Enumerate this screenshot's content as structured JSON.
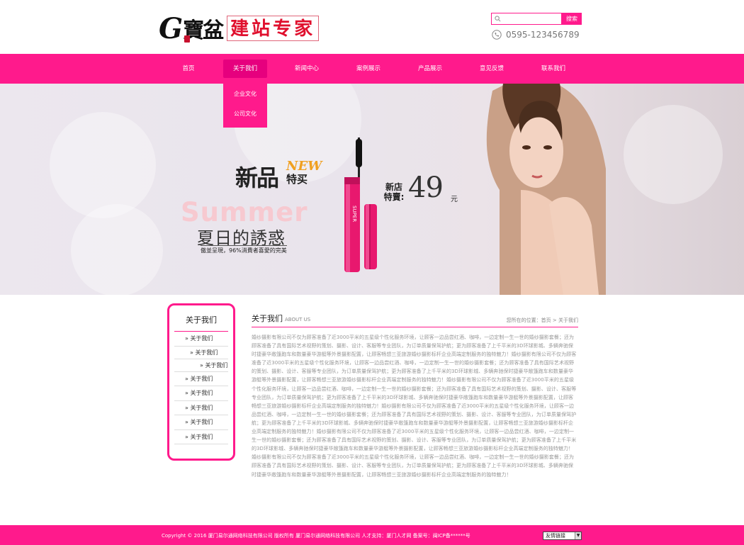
{
  "header": {
    "logo_g": "G",
    "logo_brand": "寶盆",
    "logo_box": "建站专家",
    "search_placeholder": "",
    "search_button": "搜索",
    "phone": "0595-123456789"
  },
  "nav": {
    "items": [
      {
        "label": "首页"
      },
      {
        "label": "关于我们"
      },
      {
        "label": "新闻中心"
      },
      {
        "label": "案例展示"
      },
      {
        "label": "产品展示"
      },
      {
        "label": "意见反馈"
      },
      {
        "label": "联系我们"
      }
    ],
    "dropdown": [
      "企业文化",
      "公司文化"
    ]
  },
  "banner": {
    "new_cn": "新品",
    "new_en": "NEW",
    "special": "特买",
    "summer": "Summer",
    "summer_cn": "夏日的誘惑",
    "slogan": "傲並呈現，96%消費者喜愛的完美",
    "shop": "新店特賣:",
    "price": "49",
    "yuan": "元"
  },
  "sidebar": {
    "title": "关于我们",
    "items": [
      {
        "label": "关于我们"
      },
      {
        "label": "关于我们",
        "level": 1
      },
      {
        "label": "关于我们",
        "level": 2
      },
      {
        "label": "关于我们"
      },
      {
        "label": "关于我们"
      },
      {
        "label": "关于我们"
      },
      {
        "label": "关于我们"
      },
      {
        "label": "关于我们"
      }
    ]
  },
  "main": {
    "title": "关于我们",
    "title_en": "ABOUT US",
    "breadcrumb": "您所在的位置：首页 > 关于我们",
    "body": "婚纱摄影有限公司不仅为顾客准备了近3000平米的五星级个性化服务环境，让顾客一边品尝红酒、咖啡，一边定制一生一世的婚纱摄影套餐；还为顾客准备了具有国际艺术视野的策划、摄影、设计、客服等专业团队，为订单质量保驾护航；更为顾客准备了上千平米的3D环球影城、多辆奔驰保时捷豪华敞篷跑车和数量豪华游艇等外景摄影配置，让顾客畅想三亚旅游婚纱摄影标杆企业高端定制服务的独特魅力！婚纱摄影有限公司不仅为顾客准备了近3000平米的五星级个性化服务环境，让顾客一边品尝红酒、咖啡，一边定制一生一世的婚纱摄影套餐；还为顾客准备了具有国际艺术视野的策划、摄影、设计、客服等专业团队，为订单质量保驾护航；更为顾客准备了上千平米的3D环球影城、多辆奔驰保时捷豪华敞篷跑车和数量豪华游艇等外景摄影配置，让顾客畅想三亚旅游婚纱摄影标杆企业高端定制服务的独特魅力！婚纱摄影有限公司不仅为顾客准备了近3000平米的五星级个性化服务环境，让顾客一边品尝红酒、咖啡，一边定制一生一世的婚纱摄影套餐；还为顾客准备了具有国际艺术视野的策划、摄影、设计、客服等专业团队，为订单质量保驾护航；更为顾客准备了上千平米的3D环球影城、多辆奔驰保时捷豪华敞篷跑车和数量豪华游艇等外景摄影配置，让顾客畅想三亚旅游婚纱摄影标杆企业高端定制服务的独特魅力！婚纱摄影有限公司不仅为顾客准备了近3000平米的五星级个性化服务环境，让顾客一边品尝红酒、咖啡，一边定制一生一世的婚纱摄影套餐；还为顾客准备了具有国际艺术视野的策划、摄影、设计、客服等专业团队，为订单质量保驾护航；更为顾客准备了上千平米的3D环球影城、多辆奔驰保时捷豪华敞篷跑车和数量豪华游艇等外景摄影配置，让顾客畅想三亚旅游婚纱摄影标杆企业高端定制服务的独特魅力！婚纱摄影有限公司不仅为顾客准备了近3000平米的五星级个性化服务环境，让顾客一边品尝红酒、咖啡，一边定制一生一世的婚纱摄影套餐；还为顾客准备了具有国际艺术视野的策划、摄影、设计、客服等专业团队，为订单质量保驾护航；更为顾客准备了上千平米的3D环球影城、多辆奔驰保时捷豪华敞篷跑车和数量豪华游艇等外景摄影配置，让顾客畅想三亚旅游婚纱摄影标杆企业高端定制服务的独特魅力！婚纱摄影有限公司不仅为顾客准备了近3000平米的五星级个性化服务环境，让顾客一边品尝红酒、咖啡，一边定制一生一世的婚纱摄影套餐；还为顾客准备了具有国际艺术视野的策划、摄影、设计、客服等专业团队，为订单质量保驾护航；更为顾客准备了上千平米的3D环球影城、多辆奔驰保时捷豪华敞篷跑车和数量豪华游艇等外景摄影配置，让顾客畅想三亚旅游婚纱摄影标杆企业高端定制服务的独特魅力！"
  },
  "footer": {
    "copyright": "Copyright © 2016 厦门易尔通网络科技有限公司 版权所有 厦门易尔通网络科技有限公司 人才支持：厦门人才网 备案号：闽ICP备******号",
    "links_label": "友情链接"
  },
  "colors": {
    "accent": "#ff1a8c",
    "accent_dark": "#e6007e"
  }
}
